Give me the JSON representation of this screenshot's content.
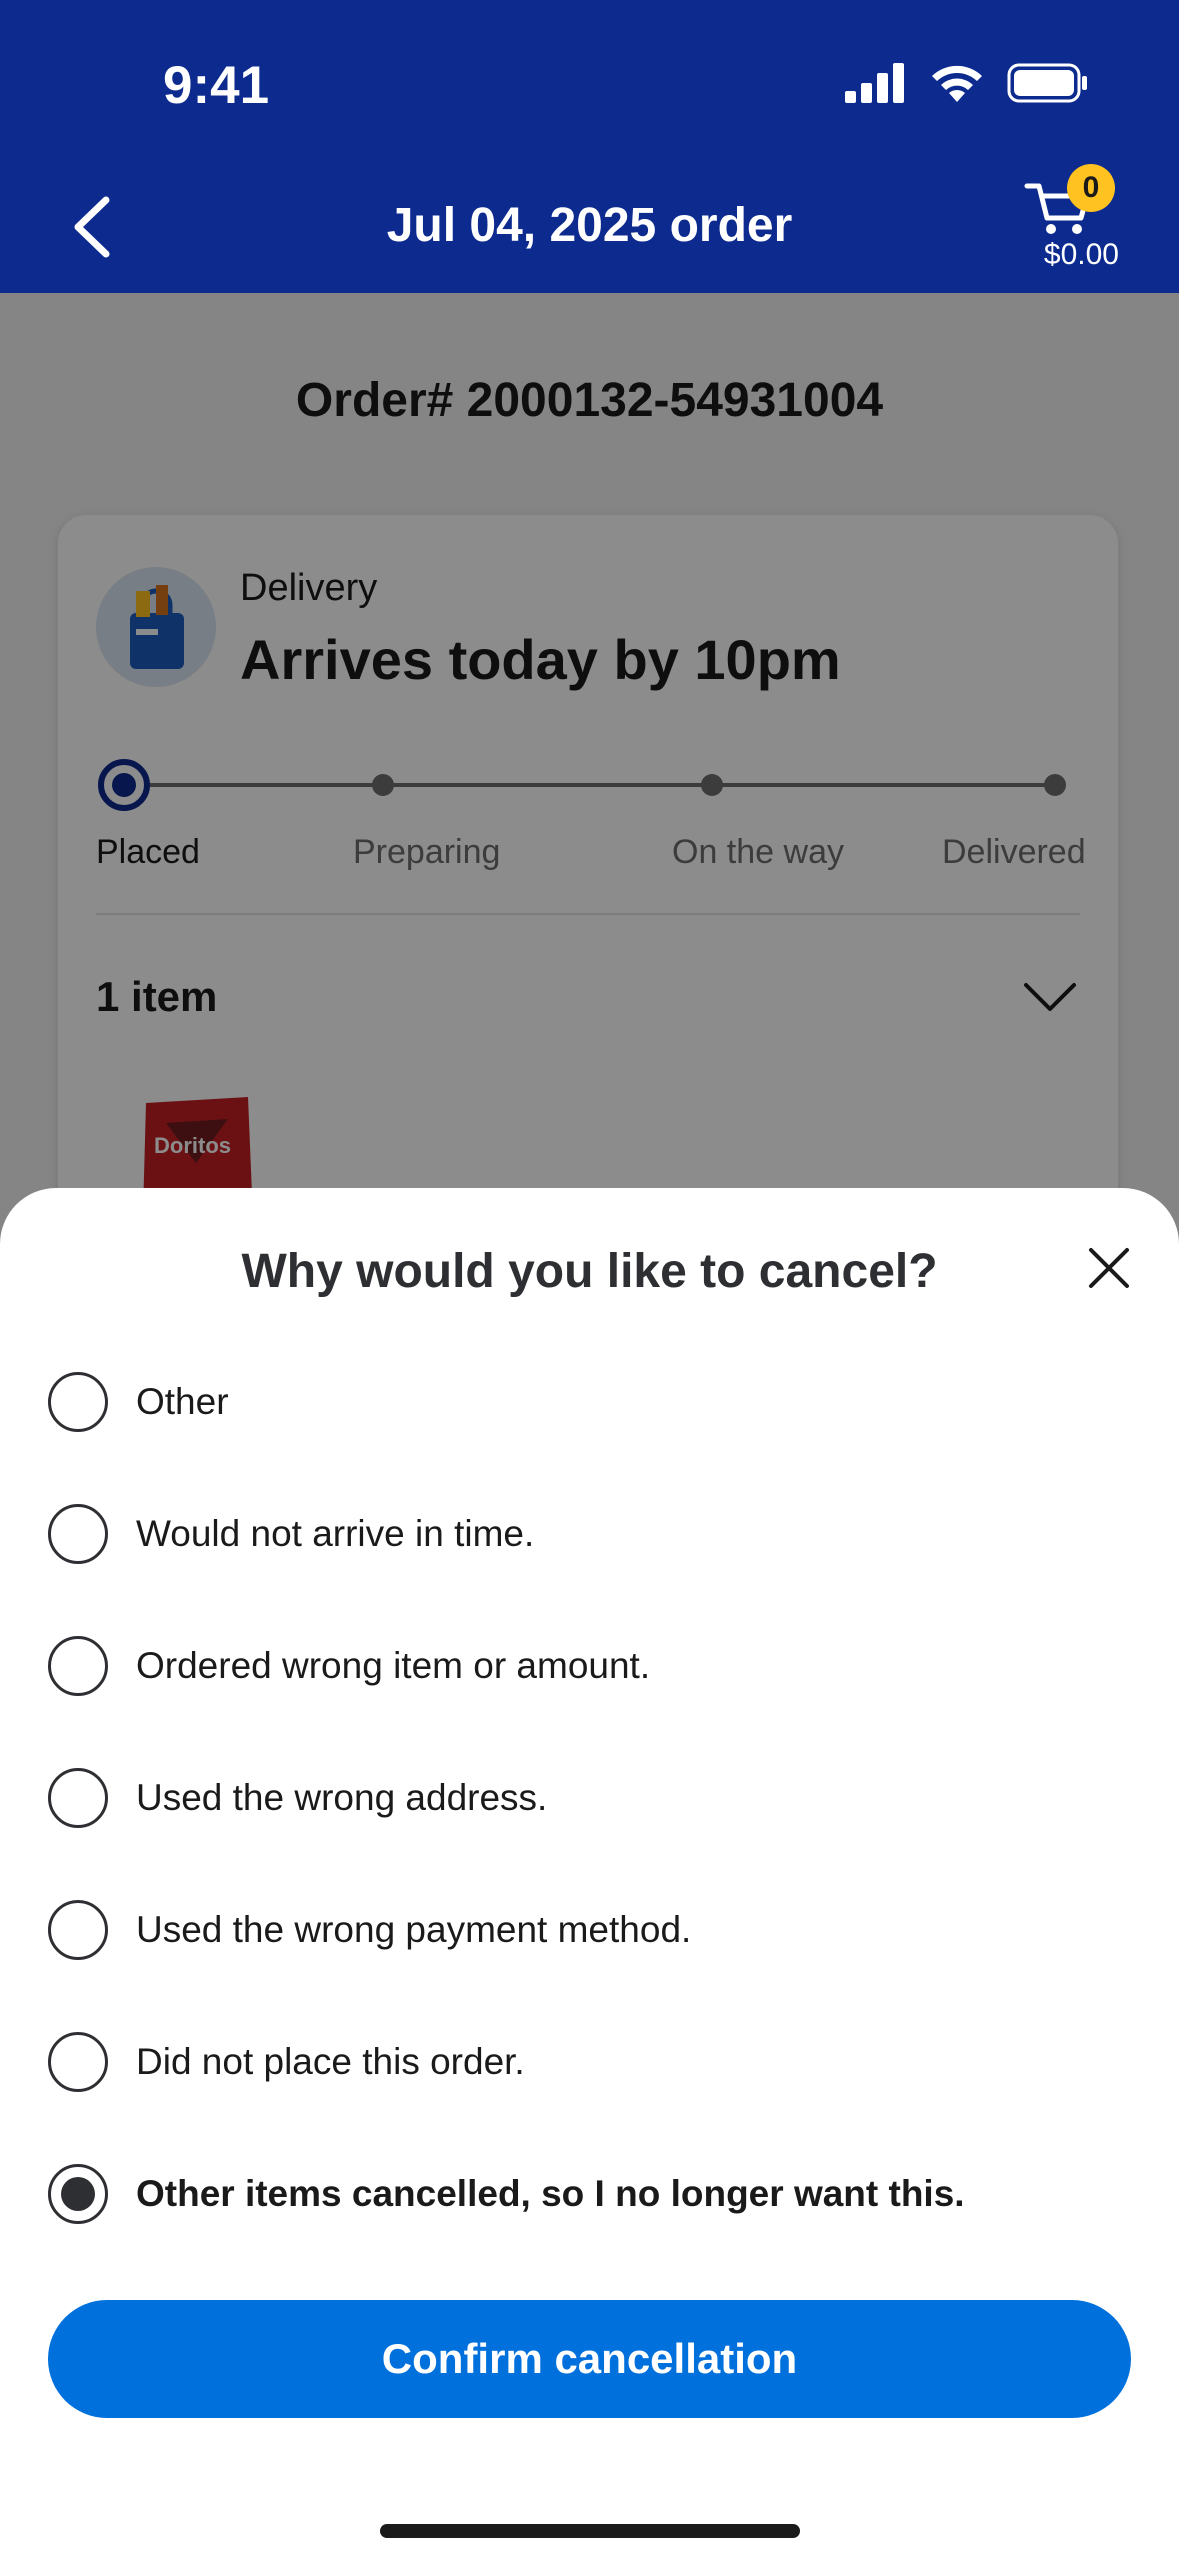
{
  "status_bar": {
    "time": "9:41"
  },
  "header": {
    "title": "Jul 04, 2025 order",
    "cart_count": "0",
    "cart_total": "$0.00"
  },
  "order": {
    "number": "Order# 2000132-54931004",
    "delivery_label": "Delivery",
    "arrival": "Arrives today by 10pm",
    "tracker_steps": [
      "Placed",
      "Preparing",
      "On the way",
      "Delivered"
    ],
    "current_step": "Placed",
    "items_count": "1 item",
    "product_brand": "Doritos"
  },
  "cancel_sheet": {
    "title": "Why would you like to cancel?",
    "options": [
      {
        "label": "Other",
        "selected": false
      },
      {
        "label": "Would not arrive in time.",
        "selected": false
      },
      {
        "label": "Ordered wrong item or amount.",
        "selected": false
      },
      {
        "label": "Used the wrong address.",
        "selected": false
      },
      {
        "label": "Used the wrong payment method.",
        "selected": false
      },
      {
        "label": "Did not place this order.",
        "selected": false
      },
      {
        "label": "Other items cancelled, so I no longer want this.",
        "selected": true
      }
    ],
    "confirm_label": "Confirm cancellation"
  },
  "colors": {
    "header_bg": "#0d2b8f",
    "primary_button": "#0071dc",
    "badge": "#ffc220"
  }
}
